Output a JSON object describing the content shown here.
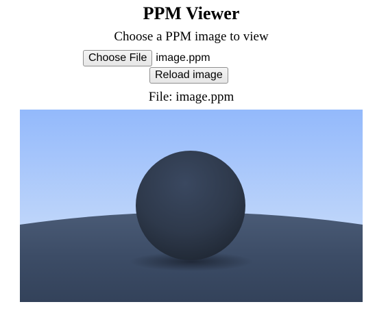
{
  "page": {
    "title": "PPM Viewer",
    "subtitle": "Choose a PPM image to view"
  },
  "file_input": {
    "button_label": "Choose File",
    "selected_file": "image.ppm"
  },
  "reload": {
    "button_label": "Reload image"
  },
  "file_label": "File: image.ppm",
  "image": {
    "alt": "rendered ppm image of a dark sphere on a ground plane under a blue sky",
    "sky_top_color": "#93b9fb",
    "sky_bottom_color": "#dbe8fa",
    "ground_color": "#3a4a63",
    "sphere_color": "#2f3b4e"
  }
}
